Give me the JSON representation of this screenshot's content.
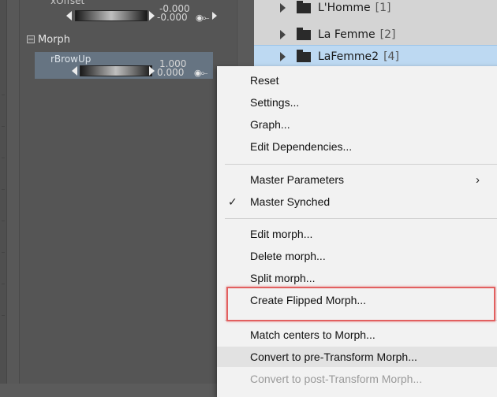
{
  "params": {
    "offset_row": {
      "label": "xOffset",
      "value_top": "-0.000",
      "value_bottom": "-0.000"
    },
    "group": {
      "label": "Morph",
      "toggle": "−"
    },
    "brow_row": {
      "label": "rBrowUp",
      "value_top": "1.000",
      "value_bottom": "0.000"
    },
    "key_glyph": "◉⟜"
  },
  "hierarchy": {
    "items": [
      {
        "name": "L'Homme",
        "count": "[1]"
      },
      {
        "name": "La Femme",
        "count": "[2]"
      },
      {
        "name": "LaFemme2",
        "count": "[4]"
      }
    ]
  },
  "context_menu": {
    "reset": "Reset",
    "settings": "Settings...",
    "graph": "Graph...",
    "edit_dependencies": "Edit Dependencies...",
    "master_parameters": "Master Parameters",
    "submenu_arrow": "›",
    "check": "✓",
    "master_synched": "Master Synched",
    "edit_morph": "Edit morph...",
    "delete_morph": "Delete morph...",
    "split_morph": "Split morph...",
    "create_flipped_morph": "Create Flipped Morph...",
    "match_centers": "Match centers to Morph...",
    "convert_pre": "Convert to pre-Transform Morph...",
    "convert_post": "Convert to post-Transform Morph..."
  },
  "colors": {
    "highlight_box": "#e26060",
    "selected_row": "#bdd9f2"
  }
}
